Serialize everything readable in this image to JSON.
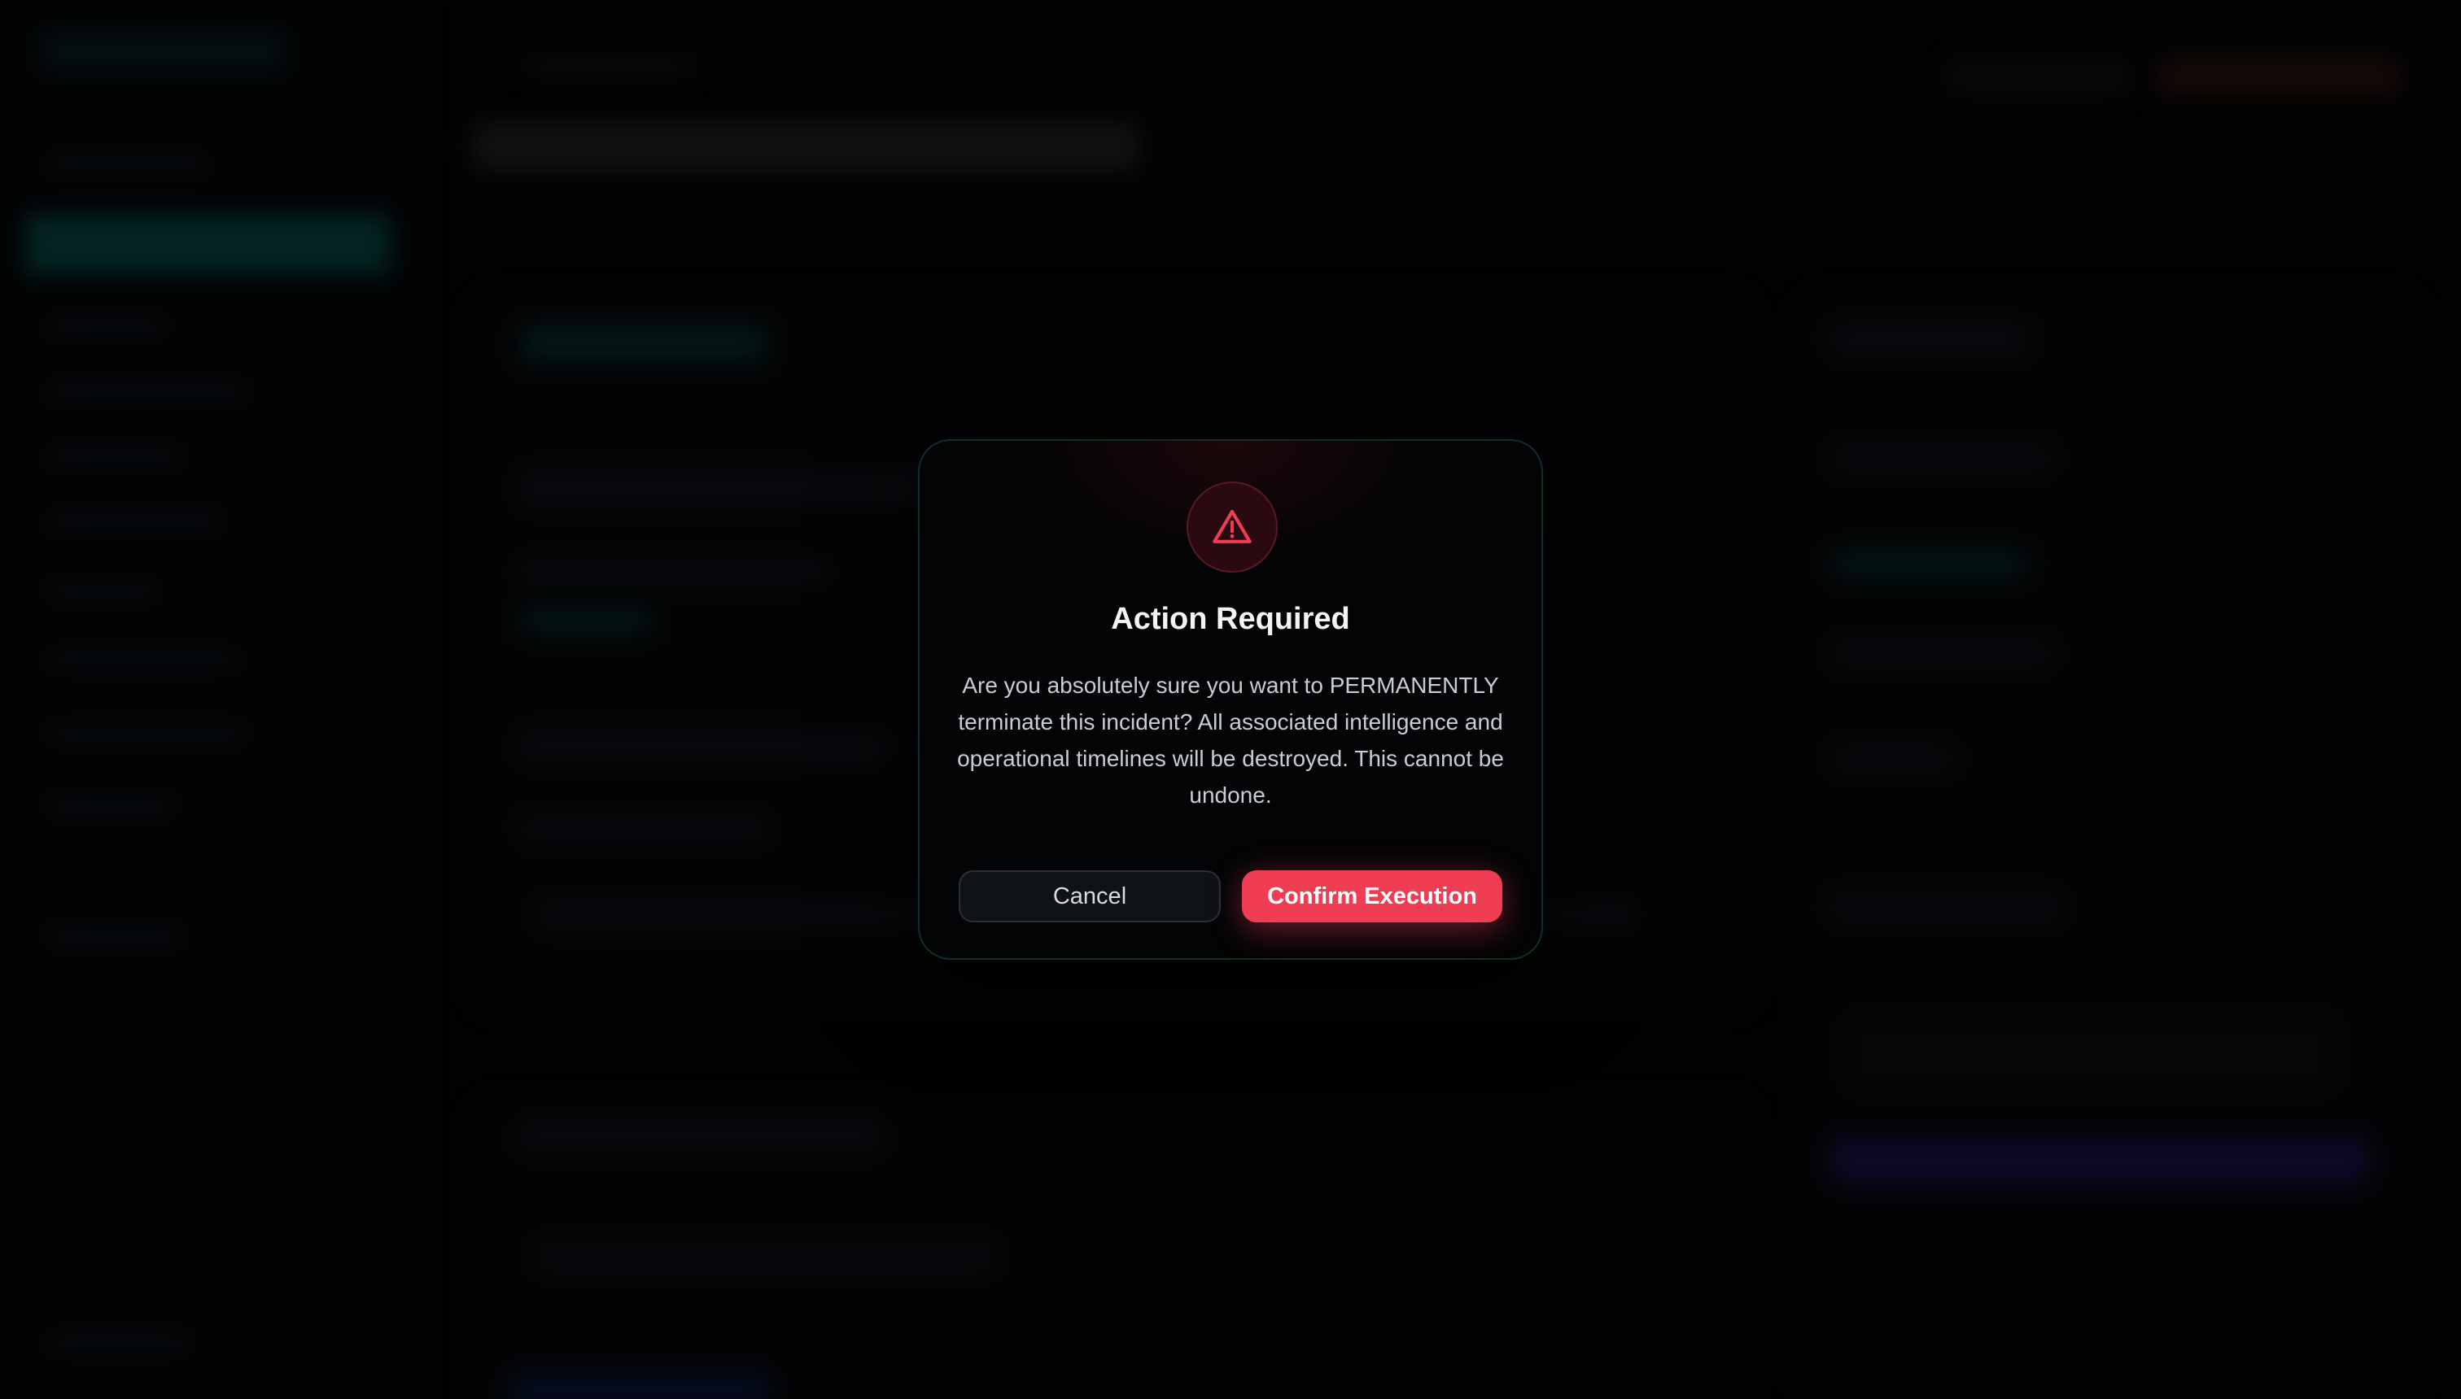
{
  "dialog": {
    "title": "Action Required",
    "message": "Are you absolutely sure you want to PERMANENTLY terminate this incident? All associated intelligence and operational timelines will be destroyed. This cannot be undone.",
    "icon": "warning-triangle-icon",
    "cancel_label": "Cancel",
    "confirm_label": "Confirm Execution"
  },
  "colors": {
    "accent_danger": "#ef3e54",
    "accent_teal": "#0a5f5a",
    "background": "#030405"
  }
}
